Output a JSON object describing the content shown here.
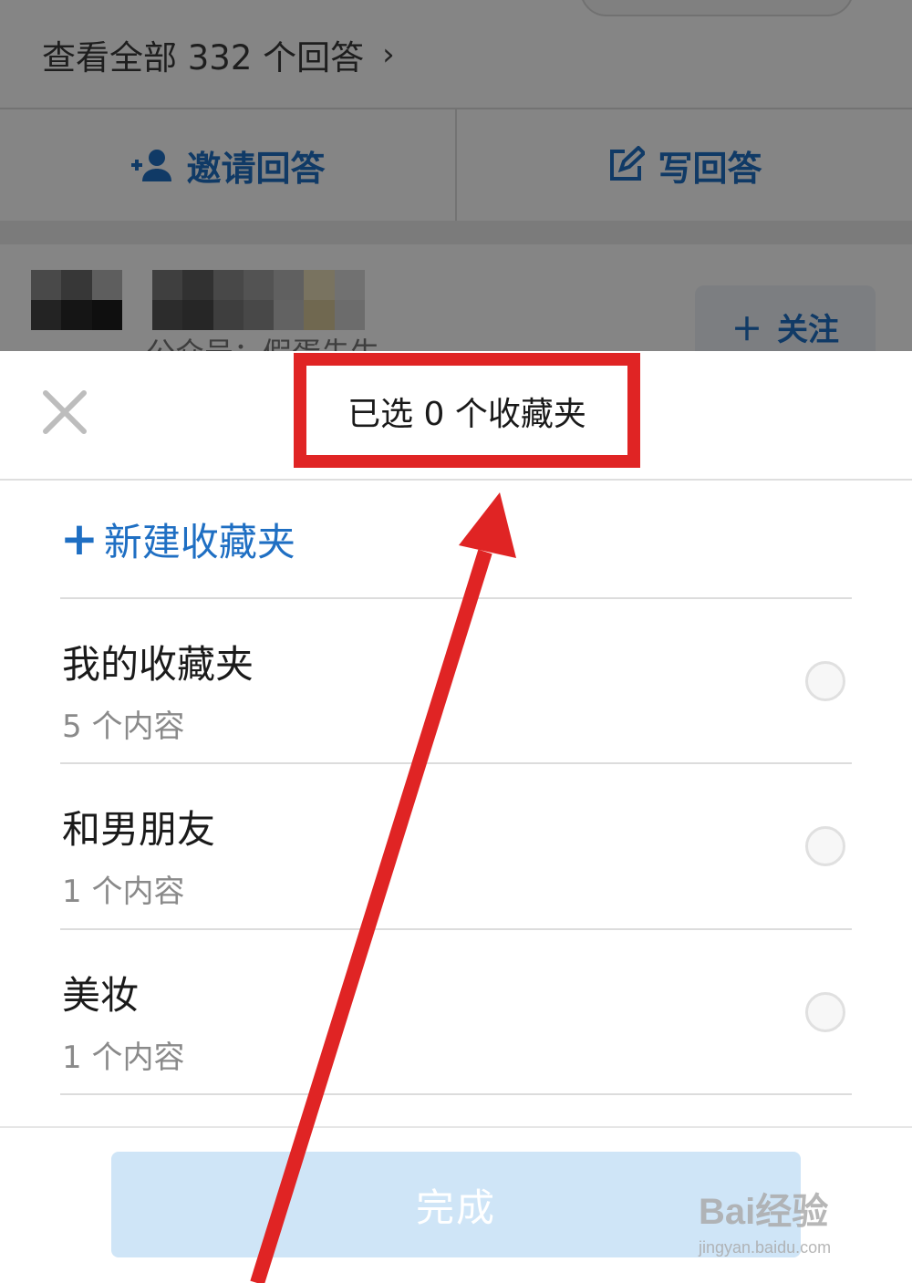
{
  "background": {
    "view_all": "查看全部 332 个回答",
    "invite_answer": "邀请回答",
    "write_answer": "写回答",
    "follow": "关注",
    "partial_caption": "公众号：假蛋先生"
  },
  "sheet": {
    "title": "已选 0 个收藏夹",
    "new_folder": "新建收藏夹",
    "folders": [
      {
        "name": "我的收藏夹",
        "count": "5 个内容",
        "selected": false
      },
      {
        "name": "和男朋友",
        "count": "1 个内容",
        "selected": false
      },
      {
        "name": "美妆",
        "count": "1 个内容",
        "selected": false
      }
    ],
    "done": "完成"
  },
  "watermark": {
    "logo": "Bai经验",
    "sub": "jingyan.baidu.com"
  },
  "colors": {
    "accent": "#1f6fc3",
    "annotation": "#e02424",
    "done_disabled": "#cfe5f7"
  }
}
